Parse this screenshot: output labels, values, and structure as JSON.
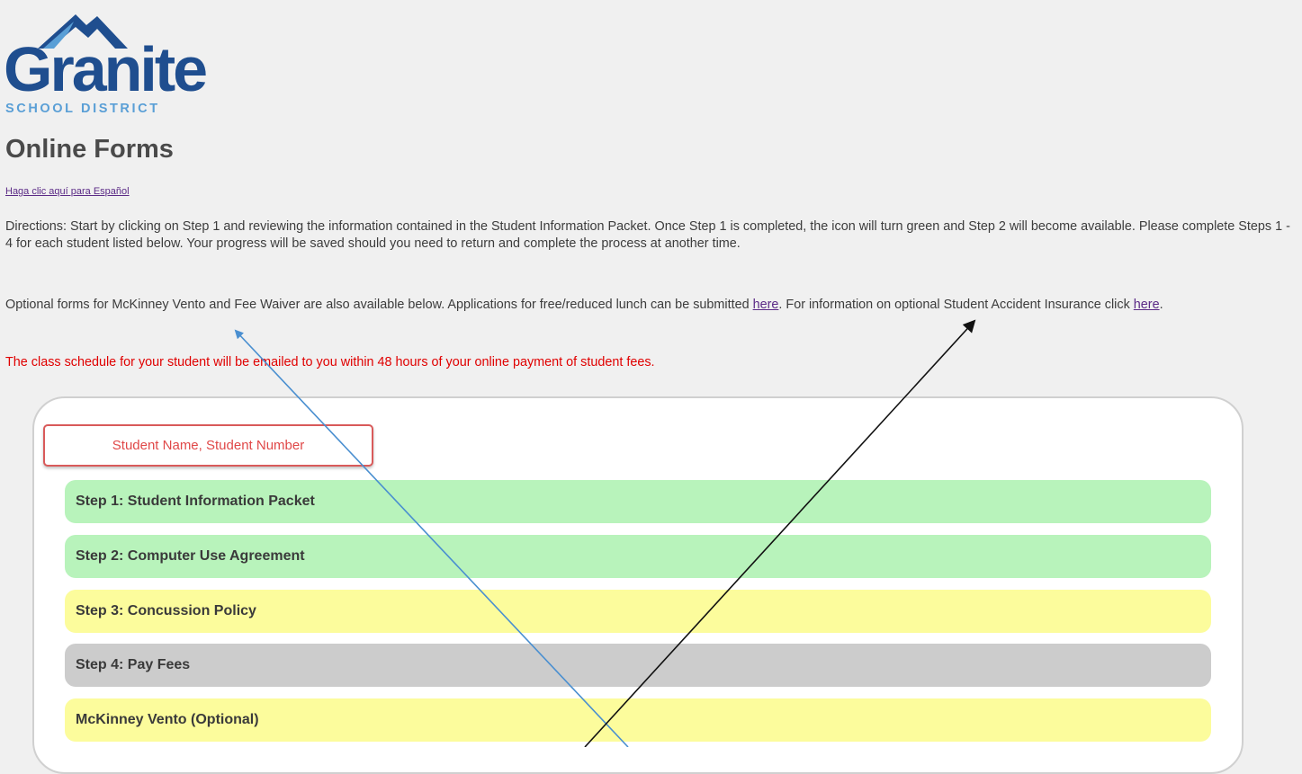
{
  "logo": {
    "word": "Granite",
    "subtitle": "SCHOOL DISTRICT",
    "colors": {
      "primary": "#1f4e8f",
      "accent": "#5a9fd6"
    }
  },
  "page_title": "Online Forms",
  "spanish_link": "Haga clic aquí para Español",
  "directions": "Directions: Start by clicking on Step 1 and reviewing the information contained in the Student Information Packet. Once Step 1 is completed, the icon will turn green and Step 2 will become available. Please complete Steps 1 - 4 for each student listed below. Your progress will be saved should you need to return and complete the process at another time.",
  "optional": {
    "text1": "Optional forms for McKinney Vento and Fee Waiver are also available below. Applications for free/reduced lunch can be submitted ",
    "link1": "here",
    "text2": ". For information on optional Student Accident Insurance click ",
    "link2": "here",
    "text3": "."
  },
  "schedule_notice": "The class schedule for your student will be emailed to you within 48 hours of your online payment of student fees.",
  "student_box": "Student Name, Student Number",
  "steps": [
    {
      "label": "Step 1: Student Information Packet",
      "status": "completed",
      "color": "#b8f3bb"
    },
    {
      "label": "Step 2: Computer Use Agreement",
      "status": "completed",
      "color": "#b8f3bb"
    },
    {
      "label": "Step 3: Concussion Policy",
      "status": "available",
      "color": "#fcfc9c"
    },
    {
      "label": "Step 4: Pay Fees",
      "status": "unavailable",
      "color": "#cccccc"
    },
    {
      "label": "McKinney Vento (Optional)",
      "status": "available",
      "color": "#fcfc9c"
    }
  ],
  "colors": {
    "notice": "#e00000",
    "link": "#5b2a86"
  }
}
